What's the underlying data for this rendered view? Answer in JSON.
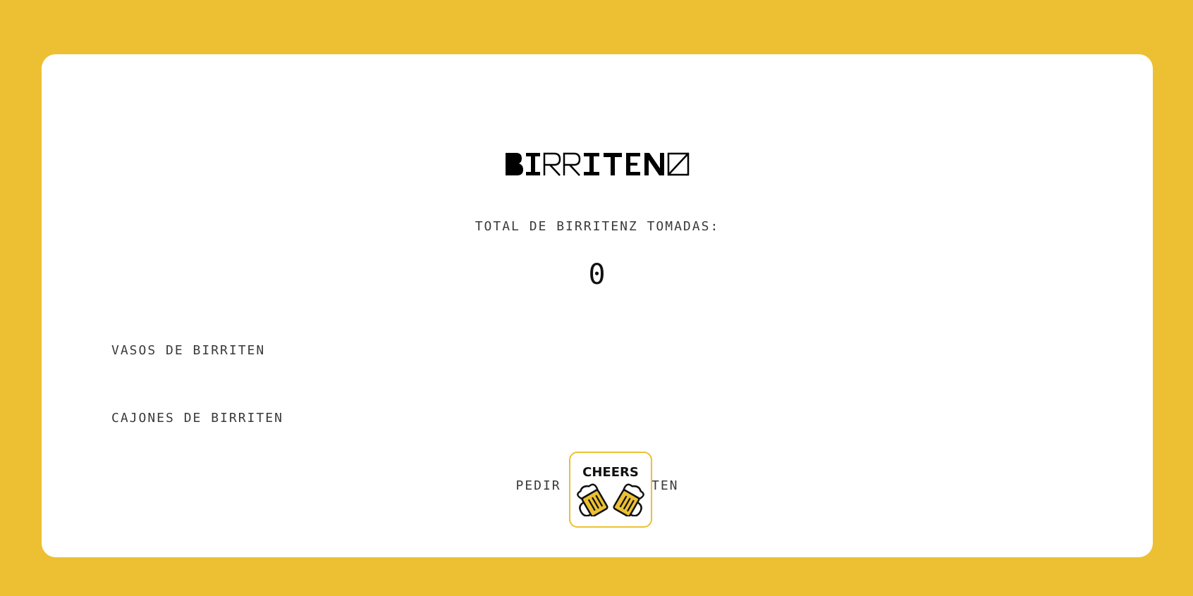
{
  "header": {
    "logo_text": "BIRRITENZ"
  },
  "counter": {
    "label": "TOTAL DE BIRRITENZ TOMADAS:",
    "value": "0"
  },
  "sections": {
    "vasos_label": "VASOS DE BIRRITEN",
    "cajones_label": "CAJONES DE BIRRITEN"
  },
  "order": {
    "label": "PEDIR UNA BIRRITEN",
    "button_text": "CHEERS",
    "button_icon": "beer-mugs-icon"
  },
  "colors": {
    "background": "#ECC032",
    "card": "#FFFFFF",
    "text": "#3A3A3A",
    "accent": "#ECC032"
  }
}
